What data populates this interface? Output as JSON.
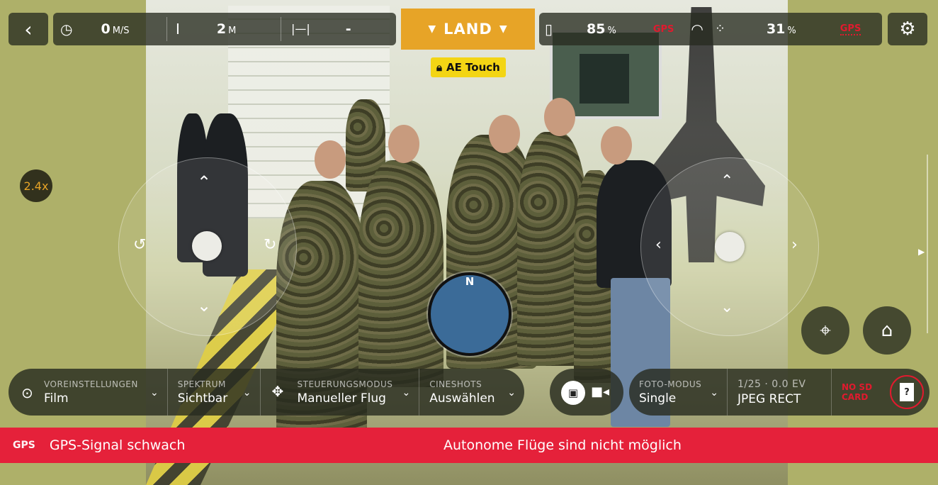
{
  "topbar": {
    "back_icon": "chevron-left-icon",
    "speed": {
      "icon": "speedometer-icon",
      "value": "0",
      "unit": "M/S"
    },
    "altitude": {
      "icon": "altitude-icon",
      "value": "2",
      "unit": "M"
    },
    "distance": {
      "icon": "distance-icon",
      "value": "-"
    },
    "land_label": "LAND",
    "ae_touch_label": "AE Touch",
    "phone_battery": {
      "icon": "phone-battery-icon",
      "value": "85",
      "unit": "%"
    },
    "gps_label": "GPS",
    "wifi_icon": "wifi-icon",
    "drone_battery": {
      "icon": "drone-battery-icon",
      "value": "31",
      "unit": "%"
    },
    "gps_status_label": "GPS",
    "settings_icon": "gear-icon"
  },
  "zoom": {
    "value": "2.4x"
  },
  "compass": {
    "label": "N"
  },
  "bottom": {
    "voreinstellungen": {
      "label": "VOREINSTELLUNGEN",
      "value": "Film"
    },
    "spektrum": {
      "label": "SPEKTRUM",
      "value": "Sichtbar"
    },
    "steuerungsmodus": {
      "label": "STEUERUNGSMODUS",
      "value": "Manueller Flug"
    },
    "cineshots": {
      "label": "CINESHOTS",
      "value": "Auswählen"
    },
    "foto_modus": {
      "label": "FOTO-MODUS",
      "value": "Single"
    },
    "exposure": {
      "label": "1/25 · 0.0 EV",
      "value": "JPEG RECT"
    },
    "sd_card": {
      "line1": "NO SD",
      "line2": "CARD"
    },
    "sd_icon_text": "?"
  },
  "alert": {
    "gps_tag": "GPS",
    "message1": "GPS-Signal schwach",
    "message2": "Autonome Flüge sind nicht möglich"
  },
  "colors": {
    "accent": "#e7a427",
    "alert": "#e5213a",
    "ae_touch": "#f3d514",
    "compass": "#3b6b98"
  }
}
